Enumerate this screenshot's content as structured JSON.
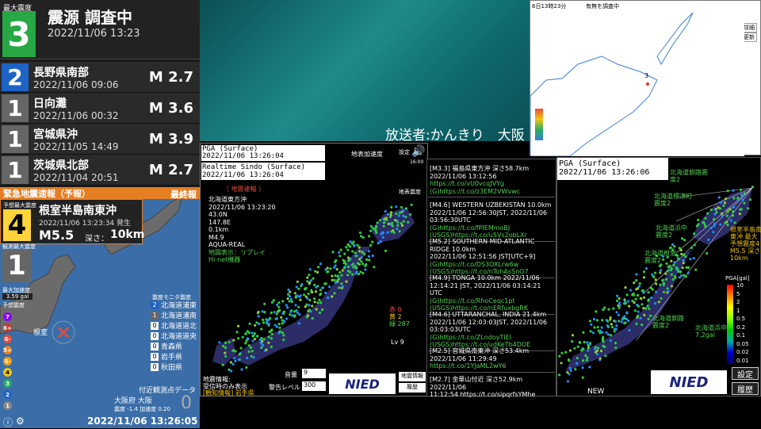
{
  "top_quake": {
    "label": "最大震度",
    "intensity": "3",
    "title": "震源 調査中",
    "time": "2022/11/06 13:23"
  },
  "history": [
    {
      "intensity": "2",
      "location": "長野県南部",
      "time": "2022/11/06 09:06",
      "mag": "M 2.7",
      "color": "#1e63c6"
    },
    {
      "intensity": "1",
      "location": "日向灘",
      "time": "2022/11/06 00:32",
      "mag": "M 3.6",
      "color": "#666"
    },
    {
      "intensity": "1",
      "location": "宮城県沖",
      "time": "2022/11/05 14:49",
      "mag": "M 3.9",
      "color": "#666"
    },
    {
      "intensity": "1",
      "location": "茨城県北部",
      "time": "2022/11/04 20:51",
      "mag": "M 2.7",
      "color": "#666"
    }
  ],
  "eew": {
    "header": "緊急地震速報（予報）",
    "final": "最終報",
    "pred_label": "予想最大震度",
    "pred_int": "4",
    "location": "根室半島南東沖",
    "time": "2022/11/06 13:23:34 発生",
    "mag": "M5.5",
    "depth_label": "深さ：",
    "depth": "10km",
    "obs_label": "観測最大震度",
    "obs_int": "1",
    "acc_label": "最大加速度",
    "acc_val": "3.59 gal",
    "scale_label": "予想震度",
    "map_label": "根室",
    "near_label": "付近観測点データ",
    "near_city": "大阪府 大阪",
    "near_vals": "震度 -1.4 加速度 0.20",
    "near_big": "0",
    "clock": "2022/11/06 13:26:05"
  },
  "legend": [
    "7",
    "6+",
    "6-",
    "5+",
    "5-",
    "4",
    "3",
    "2",
    "1"
  ],
  "monitor": {
    "title": "震度モニタ震度",
    "items": [
      {
        "i": "2",
        "n": "北海道浦東"
      },
      {
        "i": "1",
        "n": "北海道浦南"
      },
      {
        "i": "0",
        "n": "北海道道北"
      },
      {
        "i": "0",
        "n": "北海道道央"
      },
      {
        "i": "0",
        "n": "青森県"
      },
      {
        "i": "0",
        "n": "岩手県"
      },
      {
        "i": "0",
        "n": "秋田県"
      }
    ]
  },
  "broadcaster": "放送者:かんきり　大阪",
  "minimap": {
    "time": "6日13時23分",
    "status": "有無を調査中",
    "btns": [
      "詳細",
      "更新"
    ],
    "marker": "3"
  },
  "kmoni": {
    "pga": "PGA (Surface)",
    "time1": "2022/11/06 13:26:04",
    "rt": "Realtime Sindo (Surface)",
    "time2": "2022/11/06 13:26:04",
    "alert": "（ 地震速報 ）",
    "info": [
      "北海道東方沖",
      "2022/11/06 13:23:20",
      "43.0N",
      "147.8E",
      "0.1km",
      "M4.9",
      "AQUA-REAL"
    ],
    "replay": "地図表示：リプレイ",
    "hinet": "Hi-net機器",
    "map_title": "地表加速度",
    "settings": "設定",
    "map2": "地表震度",
    "counts": [
      "赤 0",
      "黄 2",
      "緑 287"
    ],
    "lv": "Lv 9",
    "footer1": "地震情報:",
    "footer2": "受信時のみ表示",
    "footer3": "[観知情報] 岩手県",
    "vol_label": "音量",
    "vol": "9",
    "warn_label": "警告レベル",
    "warn": "300",
    "btn_info": "地震情報",
    "btn_hist": "履歴",
    "nied": "NIED",
    "clock": "16:00"
  },
  "feed": [
    {
      "t": "[M3.3] 福島県東方沖 深さ58.7km",
      "d": "2022/11/06 13:12:56",
      "l": "https://t.co/vU0vcqJVYg",
      "l2": "(G)https://t.co/z3EM2VWvwc"
    },
    {
      "t": "[M4.6] WESTERN UZBEKISTAN 10.0km",
      "d": "2022/11/06 12:56:30JST, 2022/11/06 03:56:30UTC",
      "l": "(G)https://t.co/fPIEMmoBJ",
      "l2": "(USGS)https://t.co/u5Vs2obLXr"
    },
    {
      "t": "[M5.2] SOUTHERN MID-ATLANTIC RIDGE 10.0km",
      "d": "2022/11/06 12:51:56 JST[UTC+9]",
      "l": "(G)https://t.co/DS3OXLrw6w",
      "l2": "(USGS)https://t.co/nTohAsSnO7"
    },
    {
      "t": "[M4.9] TONGA 10.0km 2022/11/06",
      "d": "12:14:21 JST, 2022/11/06 03:14:21 UTC",
      "l": "(G)https://t.co/RhoCeqc1pt",
      "l2": "(USGS)https://t.co/nERfuxbgRK"
    },
    {
      "t": "[M4.6] UTTARANCHAL, INDIA 21.4km",
      "d": "2022/11/06 12:03:03JST, 2022/11/06 03:03:03UTC",
      "l": "(G)https://t.co/ZLndoyTIEI",
      "l2": "(USGS)https://t.co/udKeTb4DOE"
    },
    {
      "t": "[M2.5] 宮城県南東沖 深さ53.4km",
      "d": "2022/11/06 11:29:49",
      "l": "https://t.co/1YJaML2wY6",
      "l2": ""
    },
    {
      "t": "[M2.7] 金華山付近 深さ52.9km 2022/11/06",
      "d": "11:12:54 https://t.co/sipqrfsYMhe",
      "l": "",
      "l2": ""
    }
  ],
  "pga_right": {
    "title": "PGA (Surface)",
    "time": "2022/11/06 13:26:06",
    "labels": [
      "北海道釧路震度2",
      "北海道標津町震度2",
      "北海道浜中震度2",
      "北海道根室震度2",
      "北海道釧路震度2",
      "北海道浜中7.2gal"
    ],
    "scale_title": "PGA[gal]",
    "scale_labels": [
      "10",
      "5",
      "2",
      "1",
      "0.5",
      "0.2",
      "0.1",
      "0.05",
      "0.02",
      "0.01"
    ],
    "eew_tag": "根室半島南東沖 最大予想震度4 M5.5 深さ10km",
    "new": "NEW",
    "btns": [
      "設定",
      "履歴"
    ],
    "nied": "NIED"
  }
}
